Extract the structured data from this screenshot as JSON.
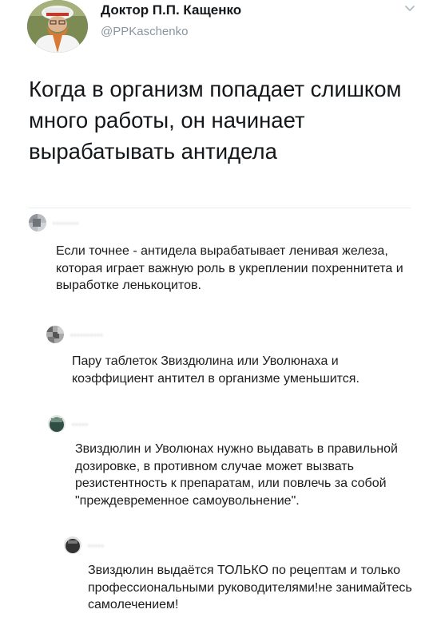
{
  "tweet": {
    "author": {
      "display_name": "Доктор П.П. Кащенко",
      "handle": "@PPKaschenko",
      "avatar_icon": "bearded-man-avatar"
    },
    "text": "Когда в организм попадает слишком много работы, он начинает вырабатывать антидела",
    "menu_icon": "chevron-down-icon"
  },
  "comments": [
    {
      "username": "••••••••",
      "avatar_color": "#9aa0a6",
      "text": "Если точнее - антидела вырабатывает ленивая железа, которая играет важную роль в укреплении похреннитета и выработке ленькоцитов."
    },
    {
      "username": "••••••••••",
      "avatar_color": "#8c8c8c",
      "text": "Пару таблеток Звиздюлина или Уволюнаха и коэффициент антител в организме уменьшится."
    },
    {
      "username": "•••••",
      "avatar_color": "#4a6a5a",
      "text": "Звиздюлин и Уволюнах нужно выдавать в правильной дозировке, в противном случае может вызвать резистентность к препаратам, или повлечь за собой \"преждевременное самоувольнение\"."
    },
    {
      "username": "•••••",
      "avatar_color": "#3d3d3d",
      "text": "Звиздюлин выдаётся ТОЛЬКО по рецептам и только профессиональными руководителями!не занимайтесь самолечением!"
    }
  ]
}
